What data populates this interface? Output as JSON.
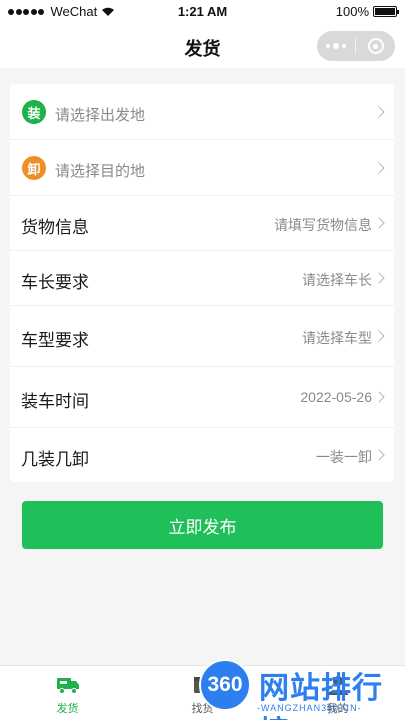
{
  "status_bar": {
    "carrier": "WeChat",
    "time": "1:21 AM",
    "battery_percent": "100%",
    "battery_level": 1.0
  },
  "nav": {
    "title": "发货"
  },
  "locations": [
    {
      "badge": "装",
      "placeholder": "请选择出发地",
      "badge_color": "#1fb14a"
    },
    {
      "badge": "卸",
      "placeholder": "请选择目的地",
      "badge_color": "#f08f2a"
    }
  ],
  "fields": [
    {
      "label": "货物信息",
      "value": "请填写货物信息"
    },
    {
      "label": "车长要求",
      "value": "请选择车长"
    },
    {
      "label": "车型要求",
      "value": "请选择车型"
    },
    {
      "label": "装车时间",
      "value": "2022-05-26"
    },
    {
      "label": "几装几卸",
      "value": "一装一卸"
    }
  ],
  "publish_button": {
    "label": "立即发布",
    "color": "#1fbf5a"
  },
  "tabs": [
    {
      "label": "发货",
      "icon": "truck-icon",
      "active": true
    },
    {
      "label": "找货",
      "icon": "box-icon",
      "active": false
    },
    {
      "label": "我的",
      "icon": "user-icon",
      "active": false
    }
  ],
  "watermark": {
    "badge": "360",
    "title": "网站排行榜",
    "subtitle": "-WANGZHAN360.CN-"
  },
  "colors": {
    "accent": "#1fb14a",
    "unload": "#f08f2a",
    "watermark": "#2d7ff0"
  }
}
